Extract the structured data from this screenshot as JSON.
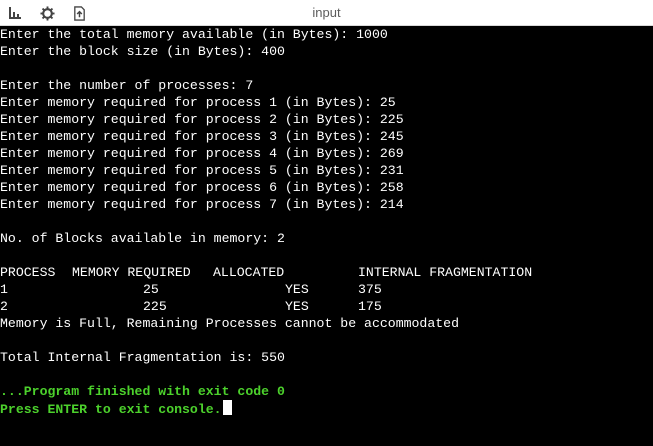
{
  "toolbar": {
    "title": "input",
    "icons": [
      "bars-icon",
      "gear-icon",
      "upload-file-icon"
    ]
  },
  "console": {
    "lines": [
      "Enter the total memory available (in Bytes): 1000",
      "Enter the block size (in Bytes): 400",
      "",
      "Enter the number of processes: 7",
      "Enter memory required for process 1 (in Bytes): 25",
      "Enter memory required for process 2 (in Bytes): 225",
      "Enter memory required for process 3 (in Bytes): 245",
      "Enter memory required for process 4 (in Bytes): 269",
      "Enter memory required for process 5 (in Bytes): 231",
      "Enter memory required for process 6 (in Bytes): 258",
      "Enter memory required for process 7 (in Bytes): 214",
      "",
      "No. of Blocks available in memory: 2",
      ""
    ],
    "table": {
      "headers": [
        "PROCESS",
        "MEMORY REQUIRED",
        "ALLOCATED",
        "INTERNAL FRAGMENTATION"
      ],
      "rows": [
        [
          "1",
          "25",
          "YES",
          "375"
        ],
        [
          "2",
          "225",
          "YES",
          "175"
        ]
      ]
    },
    "after_lines": [
      "Memory is Full, Remaining Processes cannot be accommodated",
      "",
      "Total Internal Fragmentation is: 550",
      ""
    ],
    "finish_line": "...Program finished with exit code 0",
    "press_enter_line": "Press ENTER to exit console."
  },
  "colors": {
    "background": "#000000",
    "text": "#ffffff",
    "success_text": "#4cd12c",
    "toolbar_bg": "#ffffff"
  }
}
